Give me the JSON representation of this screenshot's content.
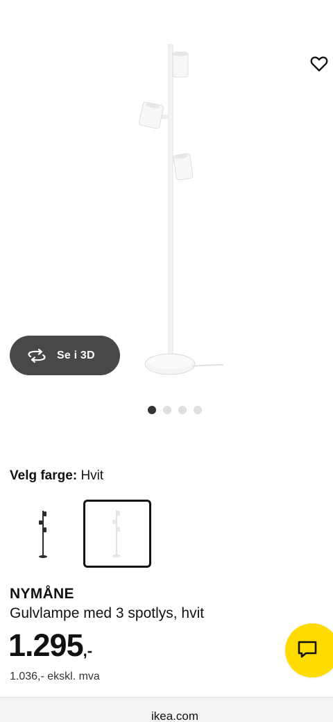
{
  "gallery": {
    "product_image": "white-floor-lamp-three-spotlights",
    "favourite_icon": "heart-icon",
    "view_3d": {
      "label": "Se i 3D",
      "icon": "rotate-3d-icon"
    },
    "pagination": {
      "total": 4,
      "active": 1
    }
  },
  "color_picker": {
    "label": "Velg farge:",
    "selected": "Hvit",
    "swatches": [
      {
        "name": "black-variant",
        "selected": false
      },
      {
        "name": "white-variant",
        "selected": true
      }
    ]
  },
  "product": {
    "name": "NYMÅNE",
    "description": "Gulvlampe med 3 spotlys, hvit",
    "price": "1.295",
    "price_suffix": ",-",
    "price_ex_vat": "1.036,- ekskl. mva"
  },
  "chat": {
    "icon": "chat-icon",
    "color": "#ffdb00"
  },
  "browser": {
    "url": "ikea.com"
  }
}
